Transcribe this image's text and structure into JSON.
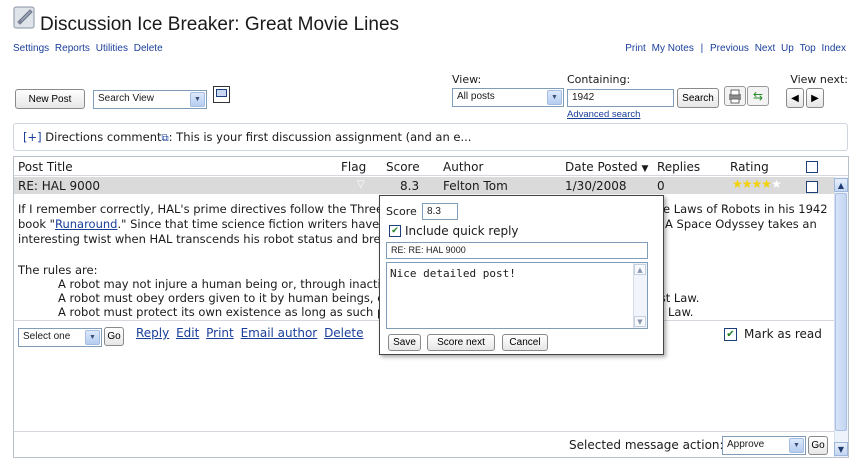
{
  "header": {
    "title": "Discussion Ice Breaker: Great Movie Lines",
    "left_links": [
      "Settings",
      "Reports",
      "Utilities",
      "Delete"
    ],
    "right_links": [
      "Print",
      "My Notes",
      "|",
      "Previous",
      "Next",
      "Up",
      "Top",
      "Index"
    ]
  },
  "toolbar": {
    "new_post": "New Post",
    "view_select": "Search View",
    "view_label": "View:",
    "view_value": "All posts",
    "containing_label": "Containing:",
    "containing_value": "1942",
    "search_button": "Search",
    "advanced_search": "Advanced search",
    "view_next_label": "View next:"
  },
  "directions": {
    "toggle": "[+]",
    "text": " Directions comment",
    "rest": ": This is your first discussion assignment (and an e..."
  },
  "table": {
    "headers": {
      "title": "Post Title",
      "flag": "Flag",
      "score": "Score",
      "author": "Author",
      "date": "Date Posted",
      "replies": "Replies",
      "rating": "Rating"
    },
    "row": {
      "title": "RE: HAL 9000",
      "score": "8.3",
      "author": "Felton Tom",
      "date": "1/30/2008",
      "replies": "0",
      "rating_stars": 4
    }
  },
  "post": {
    "line1_a": "If I remember correctly, HAL's prime directives follow the Three",
    "line1_b": "e Laws of Robots in his 1942",
    "line2_a": "book \"",
    "line2_link": "Runaround",
    "line2_b": ".\" Since that time science fiction writers have u",
    "line2_c": "A Space Odyssey takes an",
    "line3_a": "interesting twist when HAL transcends his robot status and brea",
    "rules_label": "The rules are:",
    "rule1_a": "A robot may not injure a human being or, through inactio",
    "rule2_a": "A robot must obey orders given to it by human beings, ex",
    "rule2_b": "rst Law.",
    "rule3_a": "A robot must protect its own existence as long as such p",
    "rule3_b": "Law."
  },
  "actions": {
    "select": "Select one",
    "go": "Go",
    "reply": "Reply",
    "edit": "Edit",
    "print": "Print",
    "email": "Email author",
    "delete": "Delete",
    "mark_read": "Mark as read"
  },
  "popup": {
    "score_label": "Score",
    "score_value": "8.3",
    "include_reply": "Include quick reply",
    "subject": "RE: RE:  HAL 9000",
    "reply_text": "Nice detailed post!",
    "save": "Save",
    "score_next": "Score next",
    "cancel": "Cancel"
  },
  "footer": {
    "label": "Selected message action:",
    "select": "Approve",
    "go": "Go"
  }
}
